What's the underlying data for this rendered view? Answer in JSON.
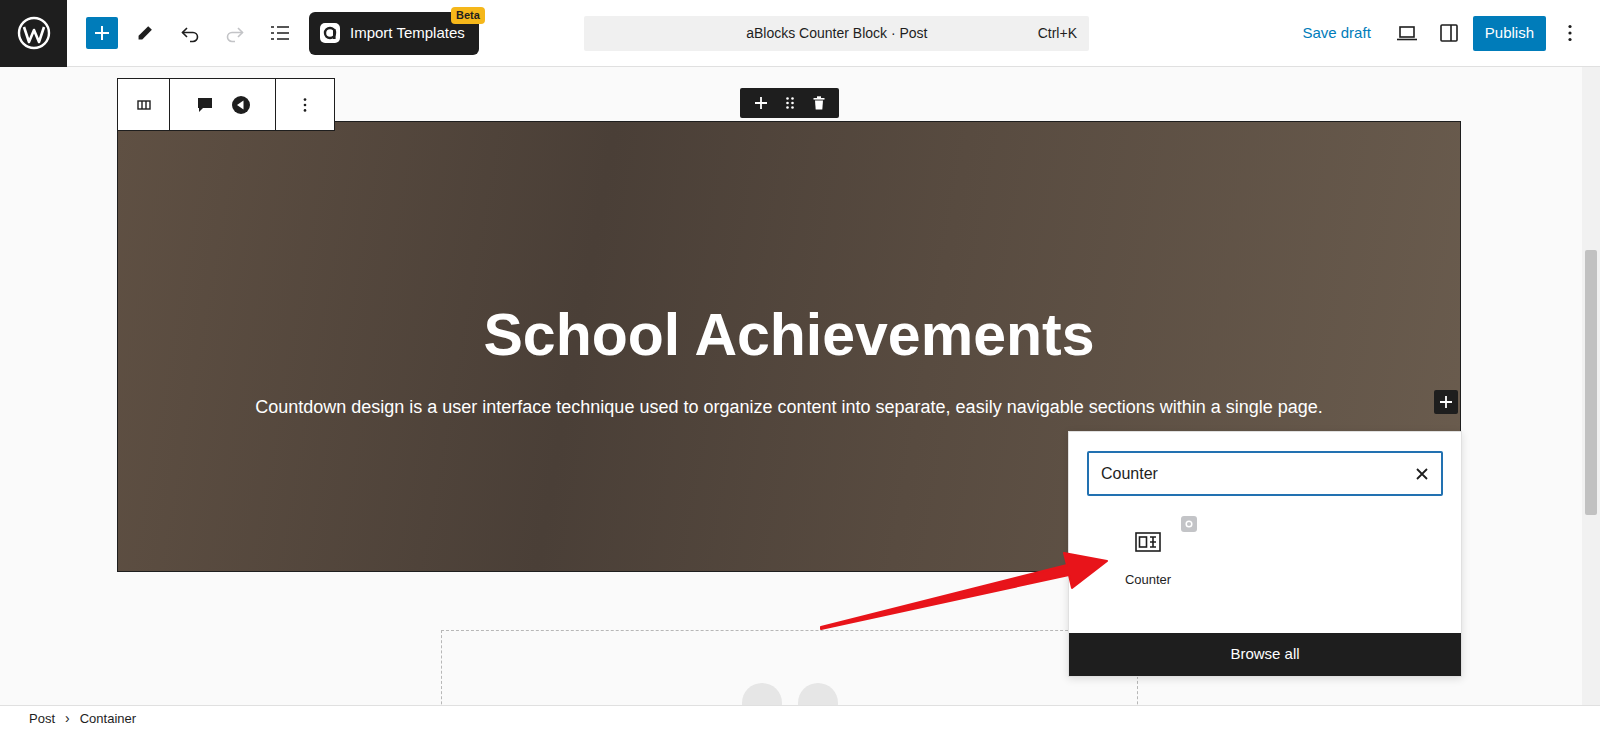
{
  "window": {
    "title": "aBlocks Counter Block · Post",
    "shortcut": "Ctrl+K"
  },
  "header": {
    "import_templates": {
      "label": "Import Templates",
      "badge": "Beta"
    },
    "history": [
      {
        "kind": "undo",
        "disabled": false
      },
      {
        "kind": "redo",
        "disabled": true
      }
    ],
    "save_draft": "Save draft",
    "publish": "Publish"
  },
  "hero": {
    "title": "School Achievements",
    "subtitle": "Countdown design is a user interface technique used to organize content into separate, easily navigable sections within a single page."
  },
  "inserter": {
    "search_value": "Counter",
    "results": [
      {
        "label": "Counter",
        "selected": false
      }
    ],
    "browse_all": "Browse all"
  },
  "breadcrumb": {
    "items": [
      "Post",
      "Container"
    ],
    "separator": "›"
  }
}
